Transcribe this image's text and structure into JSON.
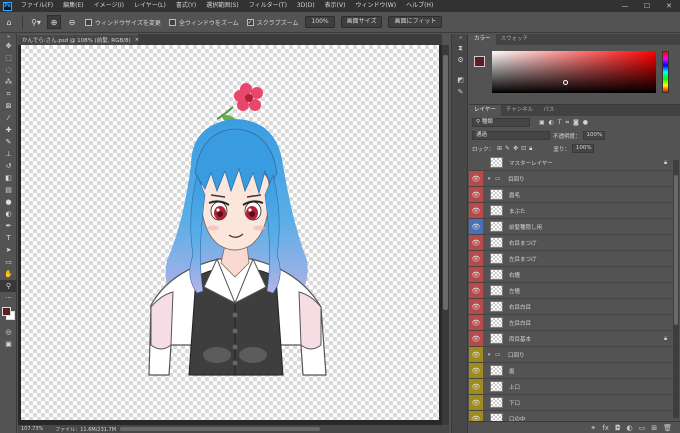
{
  "menu": [
    "ファイル(F)",
    "編集(E)",
    "イメージ(I)",
    "レイヤー(L)",
    "書式(Y)",
    "選択範囲(S)",
    "フィルター(T)",
    "3D(D)",
    "表示(V)",
    "ウィンドウ(W)",
    "ヘルプ(H)"
  ],
  "app_logo": "Ps",
  "window_controls": {
    "minimize": "—",
    "maximize": "☐",
    "close": "✕"
  },
  "options": {
    "resize_window": "ウィンドウサイズを変更",
    "all_windows_zoom": "全ウィンドウをズーム",
    "scrubby_zoom": "スクラブズーム",
    "zoom_value": "100%",
    "fit_screen": "画面サイズ",
    "fill_screen": "画面にフィット"
  },
  "document": {
    "tab_title": "かんでら:さん.psd @ 108% (前髪, RGB/8)",
    "zoom": "107.73%",
    "file_info": "ファイル：11.6M/231.7M"
  },
  "color_panel": {
    "tabs": [
      "カラー",
      "スウォッチ"
    ],
    "foreground": "#5a1f22",
    "background": "#ffffff"
  },
  "layers_panel": {
    "tabs": [
      "レイヤー",
      "チャンネル",
      "パス"
    ],
    "kind_filter": "種類",
    "blend_mode": "通過",
    "opacity_label": "不透明度：",
    "opacity": "100%",
    "lock_label": "ロック：",
    "fill_label": "塗り：",
    "fill": "100%",
    "layers": [
      {
        "name": "マスターレイヤー",
        "type": "layer",
        "visible": false,
        "eye_color": "",
        "locked": true
      },
      {
        "name": "目回り",
        "type": "group",
        "visible": true,
        "eye_color": "#b84a4a",
        "locked": false
      },
      {
        "name": "眉毛",
        "type": "layer",
        "visible": true,
        "eye_color": "#b84a4a",
        "locked": false
      },
      {
        "name": "まぶた",
        "type": "layer",
        "visible": true,
        "eye_color": "#b84a4a",
        "locked": false
      },
      {
        "name": "前髪種隠し用",
        "type": "layer",
        "visible": true,
        "eye_color": "#4a70b8",
        "locked": false
      },
      {
        "name": "右目まつげ",
        "type": "layer",
        "visible": true,
        "eye_color": "#b84a4a",
        "locked": false
      },
      {
        "name": "左目まつげ",
        "type": "layer",
        "visible": true,
        "eye_color": "#b84a4a",
        "locked": false
      },
      {
        "name": "右瞳",
        "type": "layer",
        "visible": true,
        "eye_color": "#b84a4a",
        "locked": false
      },
      {
        "name": "左瞳",
        "type": "layer",
        "visible": true,
        "eye_color": "#b84a4a",
        "locked": false
      },
      {
        "name": "右目白目",
        "type": "layer",
        "visible": true,
        "eye_color": "#b84a4a",
        "locked": false
      },
      {
        "name": "左目白目",
        "type": "layer",
        "visible": true,
        "eye_color": "#b84a4a",
        "locked": false
      },
      {
        "name": "両目基本",
        "type": "layer",
        "visible": true,
        "eye_color": "#b84a4a",
        "locked": true
      },
      {
        "name": "口回り",
        "type": "group",
        "visible": true,
        "eye_color": "#a08a1e",
        "locked": false
      },
      {
        "name": "歯",
        "type": "layer",
        "visible": true,
        "eye_color": "#a08a1e",
        "locked": false
      },
      {
        "name": "上口",
        "type": "layer",
        "visible": true,
        "eye_color": "#a08a1e",
        "locked": false
      },
      {
        "name": "下口",
        "type": "layer",
        "visible": true,
        "eye_color": "#a08a1e",
        "locked": false
      },
      {
        "name": "口の中",
        "type": "layer",
        "visible": true,
        "eye_color": "#a08a1e",
        "locked": false
      }
    ]
  },
  "tools": [
    "move-icon",
    "marquee-icon",
    "lasso-icon",
    "magic-wand-icon",
    "crop-icon",
    "frame-icon",
    "eyedropper-icon",
    "healing-icon",
    "brush-icon",
    "stamp-icon",
    "history-brush-icon",
    "eraser-icon",
    "gradient-icon",
    "blur-icon",
    "dodge-icon",
    "pen-icon",
    "type-icon",
    "path-select-icon",
    "rectangle-icon",
    "hand-icon",
    "zoom-icon",
    "more-icon"
  ]
}
